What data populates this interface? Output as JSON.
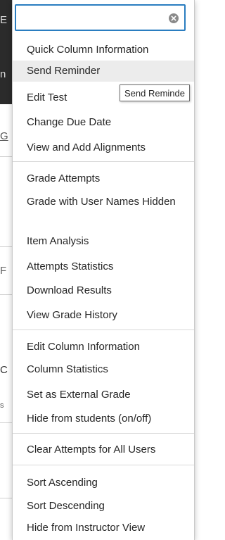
{
  "menu": {
    "search": {
      "value": "",
      "placeholder": ""
    },
    "items": [
      {
        "label": "Quick Column Information"
      },
      {
        "label": "Send Reminder"
      },
      {
        "label": "Edit Test"
      },
      {
        "label": "Change Due Date"
      },
      {
        "label": "View and Add Alignments"
      },
      {
        "label": "Grade Attempts"
      },
      {
        "label": "Grade with User Names Hidden"
      },
      {
        "label": "Item Analysis"
      },
      {
        "label": "Attempts Statistics"
      },
      {
        "label": "Download Results"
      },
      {
        "label": "View Grade History"
      },
      {
        "label": "Edit Column Information"
      },
      {
        "label": "Column Statistics"
      },
      {
        "label": "Set as External Grade"
      },
      {
        "label": "Hide from students (on/off)"
      },
      {
        "label": "Clear Attempts for All Users"
      },
      {
        "label": "Sort Ascending"
      },
      {
        "label": "Sort Descending"
      },
      {
        "label": "Hide from Instructor View"
      }
    ]
  },
  "tooltip": {
    "text": "Send Reminde"
  },
  "background": {
    "frag_e": "E",
    "frag_n": "n",
    "frag_g": "G",
    "frag_f": "F",
    "frag_c": "C",
    "frag_s": "s"
  },
  "colors": {
    "focus_ring": "#2a7dc0",
    "highlight": "#ececec",
    "text": "#262626"
  }
}
